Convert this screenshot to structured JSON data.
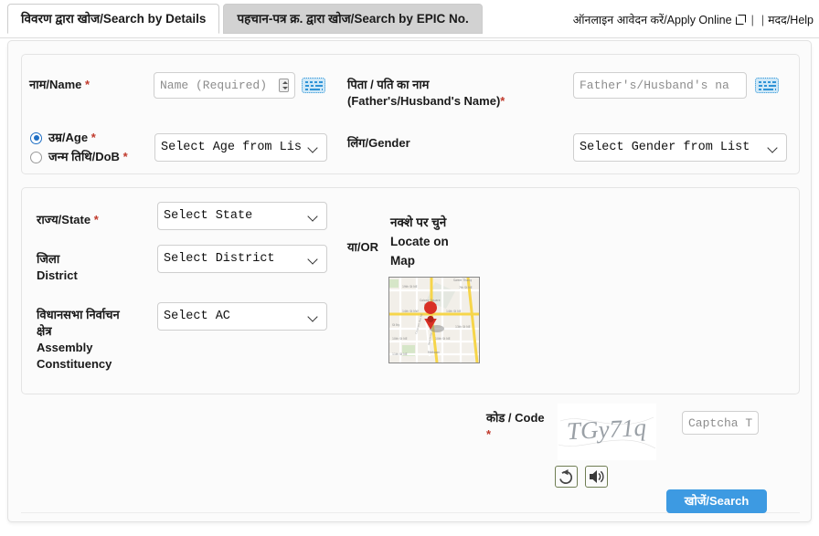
{
  "tabs": [
    {
      "id": "search-by-details",
      "label": "विवरण द्वारा खोज/Search by Details",
      "active": true
    },
    {
      "id": "search-by-epic",
      "label": "पहचान-पत्र क्र. द्वारा खोज/Search by EPIC No.",
      "active": false
    }
  ],
  "toplinks": {
    "apply_online": "ऑनलाइन आवेदन करें/Apply Online",
    "separator": "|",
    "help": "मदद/Help"
  },
  "personal": {
    "name_label": "नाम/Name",
    "name_required_mark": "*",
    "name_placeholder": "Name (Required)",
    "father_label_line1": "पिता / पति का नाम",
    "father_label_line2": "(Father's/Husband's Name)",
    "father_required_mark": "*",
    "father_placeholder": "Father's/Husband's na",
    "age_label": "उम्र/Age",
    "age_required_mark": "*",
    "dob_label": "जन्म तिथि/DoB",
    "dob_required_mark": "*",
    "age_selected": true,
    "age_select_value": "Select Age from Lis",
    "age_options": [
      "Select Age from List"
    ],
    "gender_label": "लिंग/Gender",
    "gender_select_value": "Select Gender from List",
    "gender_options": [
      "Select Gender from List"
    ]
  },
  "location": {
    "state_label": "राज्य/State",
    "state_required_mark": "*",
    "state_value": "Select State",
    "state_options": [
      "Select State"
    ],
    "district_label_line1": "जिला",
    "district_label_line2": "District",
    "district_value": "Select District",
    "district_options": [
      "Select District"
    ],
    "ac_label_line1": "विधानसभा निर्वाचन",
    "ac_label_line2": "क्षेत्र",
    "ac_label_line3": "Assembly",
    "ac_label_line4": "Constituency",
    "ac_value": "Select AC",
    "ac_options": [
      "Select AC"
    ],
    "or_text": "या/OR",
    "map_label_line1": "नक्शे पर चुने",
    "map_label_line2": "Locate on",
    "map_label_line3": "Map"
  },
  "captcha": {
    "label": "कोड / Code",
    "required_mark": "*",
    "image_text": "TGy71q",
    "input_placeholder": "Captcha T",
    "refresh_icon": "refresh-icon",
    "audio_icon": "speaker-icon"
  },
  "actions": {
    "search_label": "खोजें/Search"
  },
  "colors": {
    "accent": "#3d9ae2",
    "required": "#c0392b",
    "tab_active_bg": "#ffffff",
    "tab_inactive_bg": "#d2d2d2",
    "panel_bg": "#fbfbfb"
  }
}
